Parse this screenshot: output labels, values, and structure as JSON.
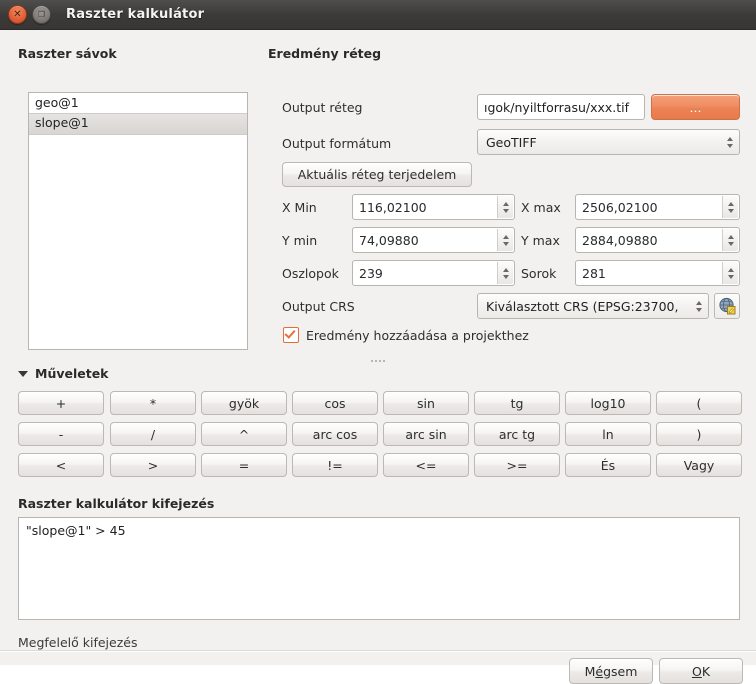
{
  "window": {
    "title": "Raszter kalkulátor",
    "close_icon": "close-icon",
    "maximize_icon": "maximize-icon"
  },
  "bands_group": {
    "title": "Raszter sávok",
    "items": [
      {
        "label": "geo@1",
        "selected": false
      },
      {
        "label": "slope@1",
        "selected": true
      }
    ]
  },
  "result_group": {
    "title": "Eredmény réteg",
    "output_layer": {
      "label": "Output réteg",
      "value": "ıgok/nyiltforrasu/xxx.tif",
      "browse_label": "...",
      "browse_color": "#ec8355"
    },
    "output_format": {
      "label": "Output formátum",
      "value": "GeoTIFF"
    },
    "current_extent_button": "Aktuális réteg terjedelem",
    "extent": {
      "x_min_label": "X Min",
      "x_min_value": "116,02100",
      "x_max_label": "X max",
      "x_max_value": "2506,02100",
      "y_min_label": "Y min",
      "y_min_value": "74,09880",
      "y_max_label": "Y max",
      "y_max_value": "2884,09880",
      "columns_label": "Oszlopok",
      "columns_value": "239",
      "rows_label": "Sorok",
      "rows_value": "281"
    },
    "output_crs": {
      "label": "Output CRS",
      "value": "Kiválasztott CRS (EPSG:23700,",
      "select_icon": "globe-crs-icon"
    },
    "add_to_project": {
      "label": "Eredmény hozzáadása a projekthez",
      "checked": true,
      "accent": "#e8703a"
    }
  },
  "operations": {
    "title": "Műveletek",
    "expanded": true,
    "rows": [
      [
        "+",
        "*",
        "gyök",
        "cos",
        "sin",
        "tg",
        "log10",
        "("
      ],
      [
        "-",
        "/",
        "^",
        "arc cos",
        "arc sin",
        "arc tg",
        "ln",
        ")"
      ],
      [
        "<",
        ">",
        "=",
        "!=",
        "<=",
        ">=",
        "És",
        "Vagy"
      ]
    ]
  },
  "expression": {
    "title": "Raszter kalkulátor kifejezés",
    "value": "\"slope@1\" > 45"
  },
  "status": {
    "text": "Megfelelő kifejezés"
  },
  "dialog_buttons": {
    "cancel": "Mégsem",
    "ok": "OK"
  }
}
